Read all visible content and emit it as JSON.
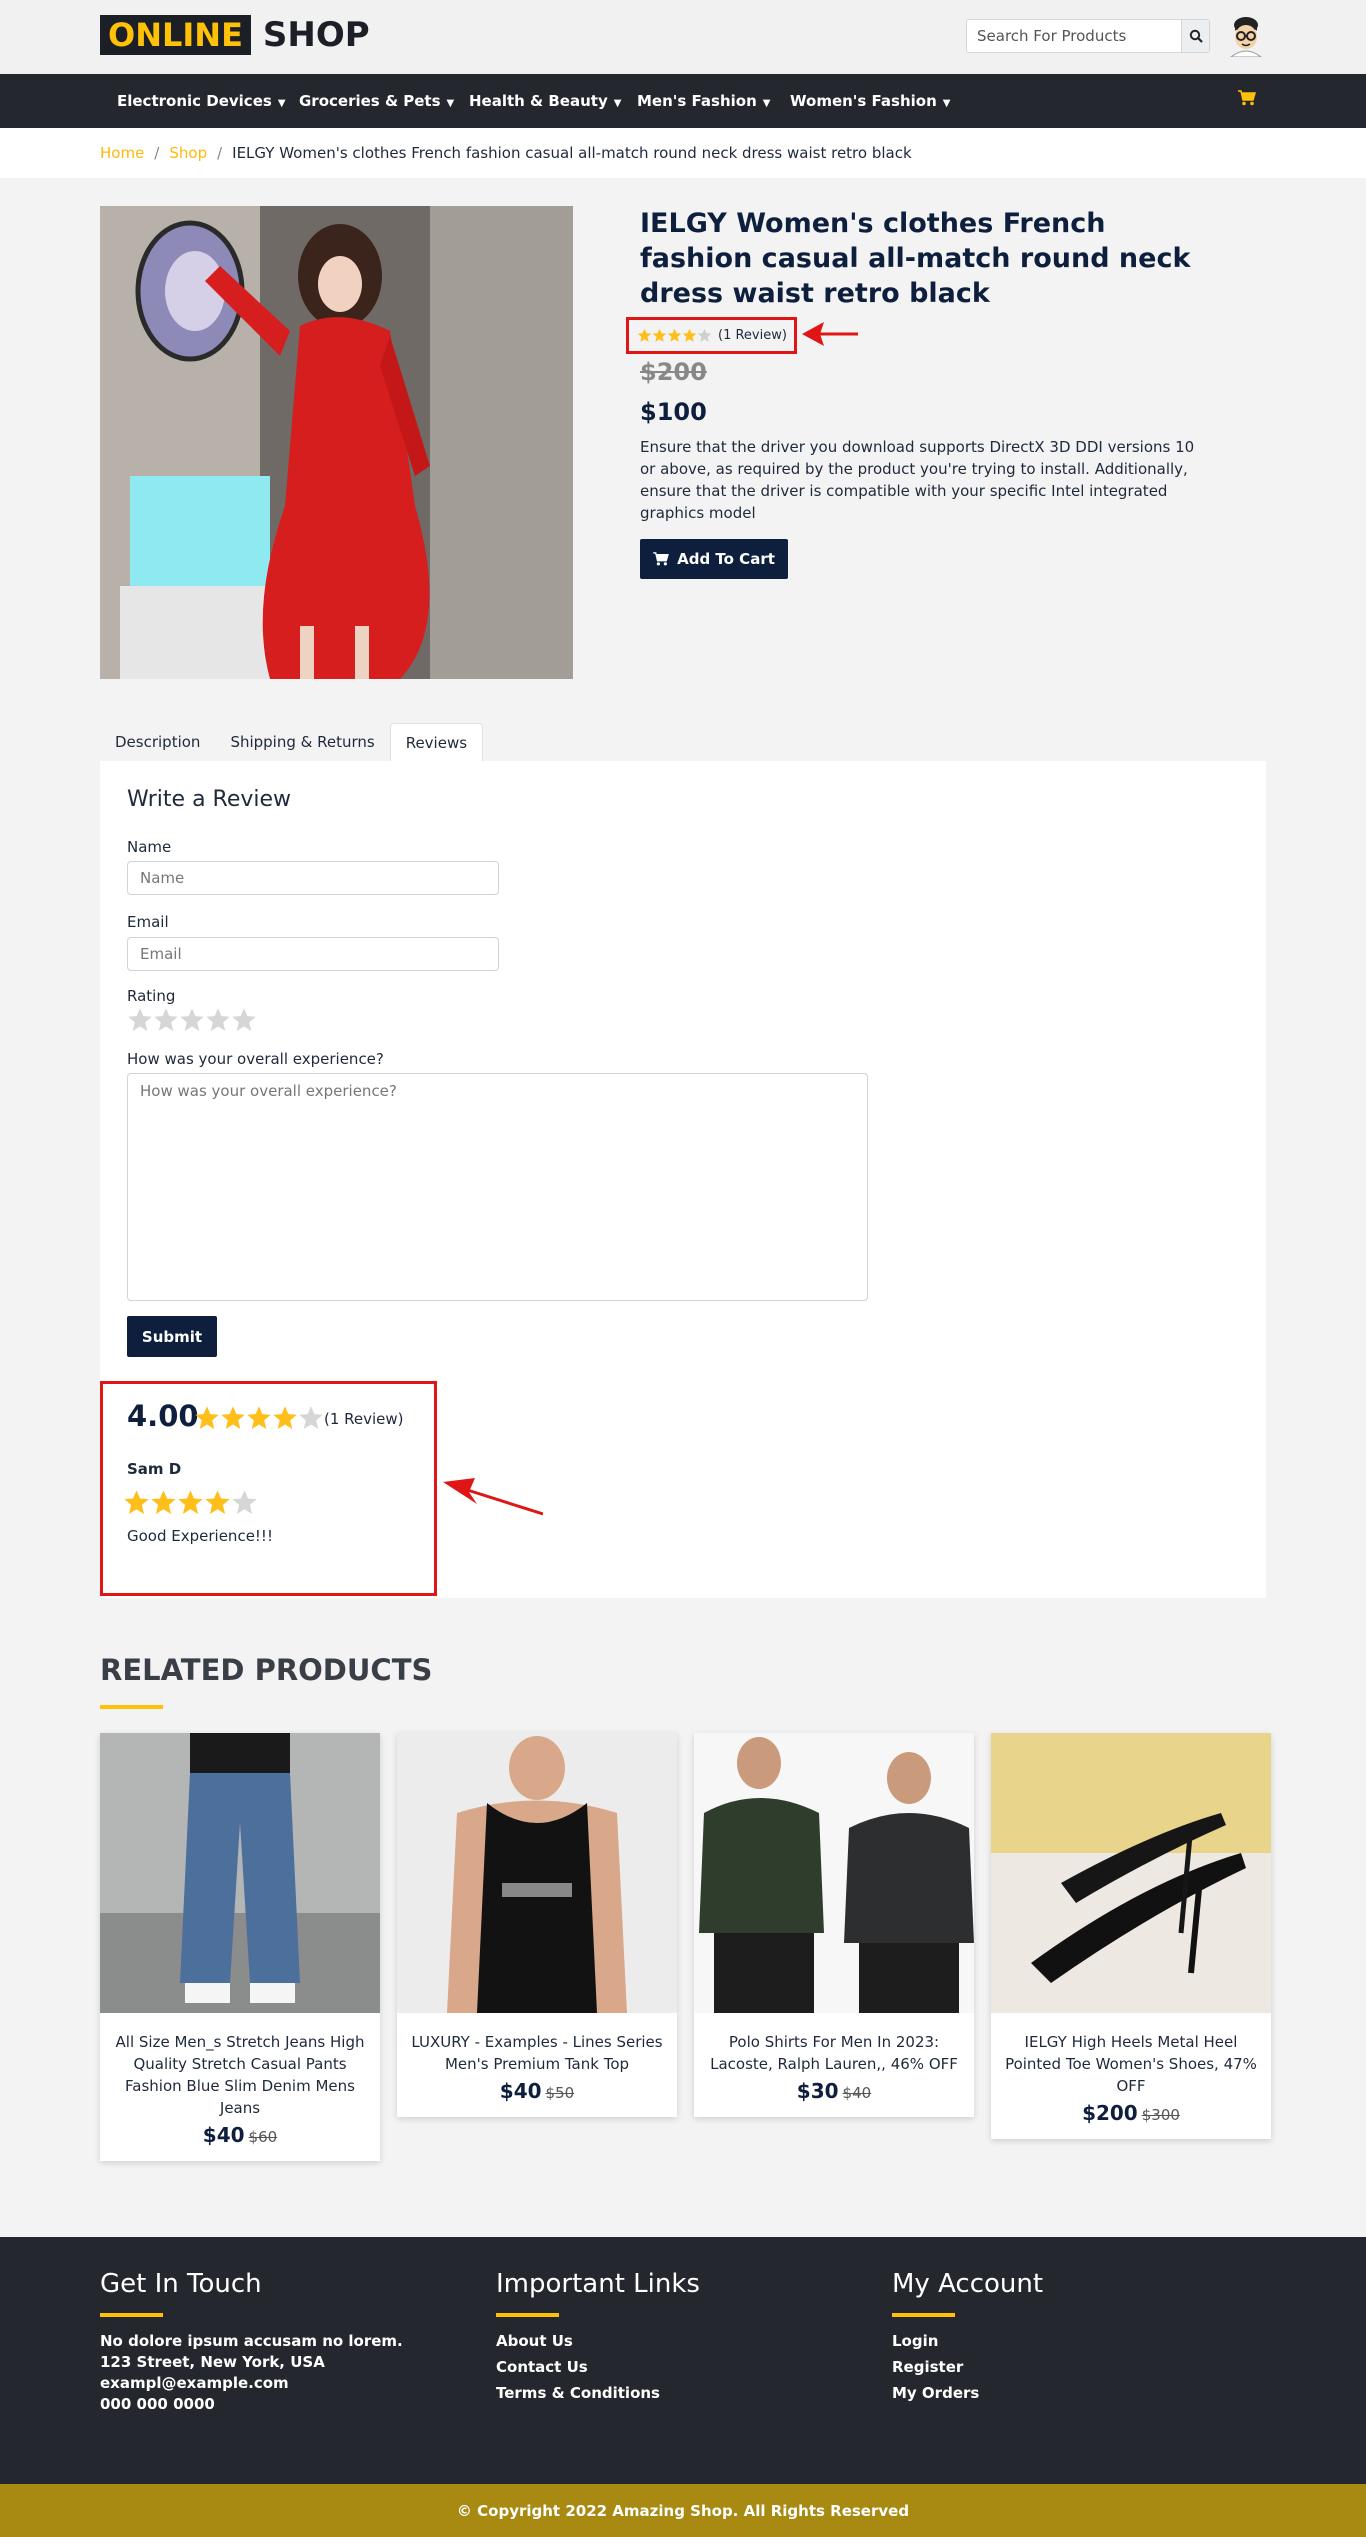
{
  "header": {
    "logo_highlight": "ONLINE",
    "logo_text": "SHOP",
    "search_placeholder": "Search For Products",
    "search_icon": "search-icon",
    "avatar_icon": "avatar-icon"
  },
  "nav": {
    "items": [
      {
        "label": "Electronic Devices"
      },
      {
        "label": "Groceries & Pets"
      },
      {
        "label": "Health & Beauty"
      },
      {
        "label": "Men's Fashion"
      },
      {
        "label": "Women's Fashion"
      }
    ],
    "cart_icon": "cart-icon",
    "accent": "#ffc107"
  },
  "breadcrumb": {
    "home": "Home",
    "sep1": "/",
    "shop": "Shop",
    "sep2": "/",
    "current": "IELGY Women's clothes French fashion casual all-match round neck dress waist retro black"
  },
  "product": {
    "title": "IELGY Women's clothes French fashion casual all-match round neck dress waist retro black",
    "rating": 4,
    "review_count": "(1 Review)",
    "old_price": "$200",
    "price": "$100",
    "description": "Ensure that the driver you download supports DirectX 3D DDI versions 10 or above, as required by the product you're trying to install. Additionally, ensure that the driver is compatible with your specific Intel integrated graphics model",
    "add_to_cart": "Add To Cart"
  },
  "tabs": [
    {
      "label": "Description"
    },
    {
      "label": "Shipping & Returns"
    },
    {
      "label": "Reviews"
    }
  ],
  "review_form": {
    "title": "Write a Review",
    "name_label": "Name",
    "name_placeholder": "Name",
    "email_label": "Email",
    "email_placeholder": "Email",
    "rating_label": "Rating",
    "experience_label": "How was your overall experience?",
    "experience_placeholder": "How was your overall experience?",
    "submit": "Submit"
  },
  "review_summary": {
    "average": "4.00",
    "average_rating": 4,
    "count": "(1 Review)",
    "reviews": [
      {
        "name": "Sam D",
        "rating": 4,
        "text": "Good Experience!!!"
      }
    ]
  },
  "related": {
    "title": "RELATED PRODUCTS",
    "items": [
      {
        "name": "All Size Men_s Stretch Jeans High Quality Stretch Casual Pants Fashion Blue Slim Denim Mens Jeans",
        "price": "$40",
        "was": "$60"
      },
      {
        "name": "LUXURY - Examples - Lines Series Men's Premium Tank Top",
        "price": "$40",
        "was": "$50"
      },
      {
        "name": "Polo Shirts For Men In 2023: Lacoste, Ralph Lauren,, 46% OFF",
        "price": "$30",
        "was": "$40"
      },
      {
        "name": "IELGY High Heels Metal Heel Pointed Toe Women's Shoes, 47% OFF",
        "price": "$200",
        "was": "$300"
      }
    ]
  },
  "footer": {
    "touch": {
      "title": "Get In Touch",
      "lines": [
        "No dolore ipsum accusam no lorem.",
        "123 Street, New York, USA",
        "exampl@example.com",
        "000 000 0000"
      ]
    },
    "links": {
      "title": "Important Links",
      "items": [
        "About Us",
        "Contact Us",
        "Terms & Conditions"
      ]
    },
    "account": {
      "title": "My Account",
      "items": [
        "Login",
        "Register",
        "My Orders"
      ]
    },
    "copyright": "© Copyright 2022 Amazing Shop. All Rights Reserved"
  },
  "colors": {
    "dark": "#24272d",
    "navy": "#0e1f3e",
    "accent": "#ffc107",
    "star": "#ffbf1a",
    "highlight_box": "#e01616",
    "copyright_bg": "#a88a12"
  }
}
